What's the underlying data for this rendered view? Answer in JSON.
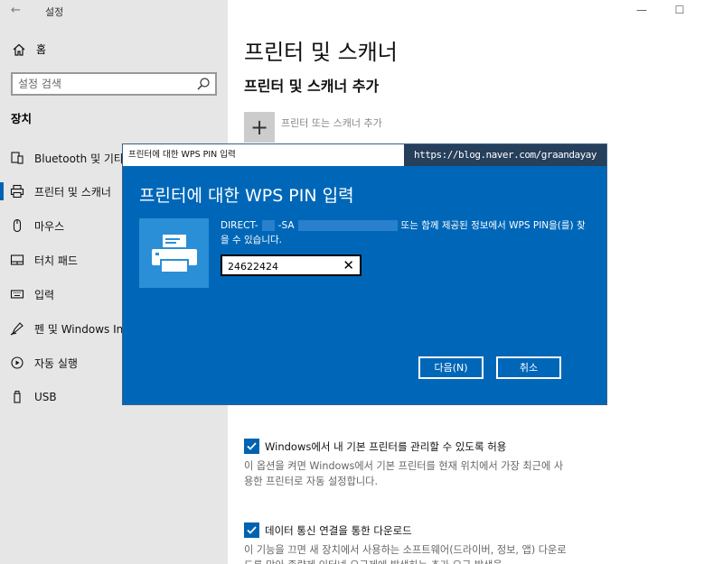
{
  "window": {
    "title": "설정",
    "back_glyph": "←",
    "minimize_glyph": "—",
    "maximize_glyph": "☐"
  },
  "sidebar": {
    "home_label": "홈",
    "search_placeholder": "설정 검색",
    "section_label": "장치",
    "items": [
      {
        "label": "Bluetooth 및 기타 장",
        "icon": "bluetooth-devices-icon"
      },
      {
        "label": "프린터 및 스캐너",
        "icon": "printer-icon",
        "active": true
      },
      {
        "label": "마우스",
        "icon": "mouse-icon"
      },
      {
        "label": "터치 패드",
        "icon": "touchpad-icon"
      },
      {
        "label": "입력",
        "icon": "keyboard-icon"
      },
      {
        "label": "펜 및 Windows Ink",
        "icon": "pen-icon"
      },
      {
        "label": "자동 실행",
        "icon": "autoplay-icon"
      },
      {
        "label": "USB",
        "icon": "usb-icon"
      }
    ]
  },
  "main": {
    "title": "프린터 및 스캐너",
    "subtitle": "프린터 및 스캐너 추가",
    "add_glyph": "+",
    "add_label": "프린터 또는 스캐너 추가",
    "options": [
      {
        "label": "Windows에서 내 기본 프린터를 관리할 수 있도록 허용",
        "checked": true,
        "description": "이 옵션을 켜면 Windows에서 기본 프린터를 현재 위치에서 가장 최근에 사용한 프린터로 자동 설정합니다."
      },
      {
        "label": "데이터 통신 연결을 통한 다운로드",
        "checked": true,
        "description": "이 기능을 끄면 새 장치에서 사용하는 소프트웨어(드라이버, 정보, 앱) 다운로드를 막아 종량제 인터넷 요금제에 발생하는 추가 요금 발생을"
      }
    ]
  },
  "dialog": {
    "window_title": "프린터에 대한 WPS PIN 입력",
    "watermark": "https://blog.naver.com/graandayay",
    "heading": "프린터에 대한 WPS PIN 입력",
    "device_prefix": "DIRECT-",
    "device_mid": "-SA",
    "message": "또는 함께 제공된 정보에서 WPS PIN을(를) 찾을 수 있습니다.",
    "pin_value": "24622424",
    "clear_glyph": "✕",
    "next_button": "다음(N)",
    "cancel_button": "취소"
  },
  "colors": {
    "accent": "#0067b8",
    "sidebar_bg": "#e6e6e6",
    "tile_bg": "#2a8fd6"
  }
}
